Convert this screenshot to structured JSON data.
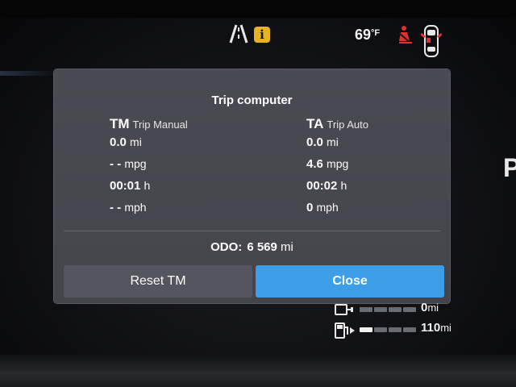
{
  "status": {
    "temperature": "69",
    "temperature_unit": "°F",
    "icons": [
      "lane-assist-icon",
      "info-icon",
      "seatbelt-warning-icon",
      "car-doors-icon"
    ],
    "info_glyph": "i"
  },
  "trip_computer": {
    "title": "Trip computer",
    "manual": {
      "abbr": "TM",
      "name": "Trip Manual",
      "distance": "0.0",
      "distance_unit": "mi",
      "economy": "- -",
      "economy_unit": "mpg",
      "time": "00:01",
      "time_unit": "h",
      "speed": "- -",
      "speed_unit": "mph"
    },
    "auto": {
      "abbr": "TA",
      "name": "Trip Auto",
      "distance": "0.0",
      "distance_unit": "mi",
      "economy": "4.6",
      "economy_unit": "mpg",
      "time": "00:02",
      "time_unit": "h",
      "speed": "0",
      "speed_unit": "mph"
    },
    "odo_label": "ODO:",
    "odo_value": "6 569",
    "odo_unit": "mi",
    "reset_label": "Reset TM",
    "close_label": "Close"
  },
  "range": {
    "electric": {
      "value": "0",
      "unit": "mi",
      "level": 0.0
    },
    "fuel": {
      "value": "110",
      "unit": "mi",
      "level": 0.25
    }
  },
  "colors": {
    "accent": "#3d9de6",
    "warning": "#e6b422",
    "alert": "#e03030"
  },
  "edge_letter": "P"
}
